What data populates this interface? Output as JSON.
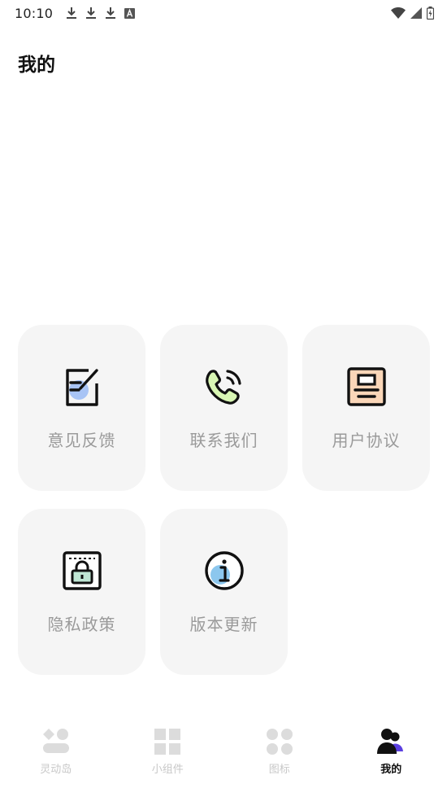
{
  "status_bar": {
    "time": "10:10",
    "icons": [
      "download-icon",
      "download-icon",
      "download-icon",
      "font-badge-icon",
      "wifi-icon",
      "signal-icon",
      "battery-icon"
    ]
  },
  "header": {
    "title": "我的"
  },
  "menu": {
    "items": [
      {
        "label": "意见反馈",
        "icon": "feedback-edit-icon"
      },
      {
        "label": "联系我们",
        "icon": "phone-call-icon"
      },
      {
        "label": "用户协议",
        "icon": "document-agreement-icon"
      },
      {
        "label": "隐私政策",
        "icon": "privacy-lock-icon"
      },
      {
        "label": "版本更新",
        "icon": "info-icon"
      }
    ]
  },
  "bottom_nav": {
    "tabs": [
      {
        "label": "灵动岛",
        "icon": "dynamic-island-icon",
        "active": false
      },
      {
        "label": "小组件",
        "icon": "widgets-grid-icon",
        "active": false
      },
      {
        "label": "图标",
        "icon": "icons-dots-icon",
        "active": false
      },
      {
        "label": "我的",
        "icon": "profile-users-icon",
        "active": true
      }
    ]
  },
  "colors": {
    "card_background": "#f5f5f5",
    "label_gray": "#9a9a9a",
    "nav_inactive": "#c8c8c8",
    "accent_purple": "#5b3fe0"
  }
}
